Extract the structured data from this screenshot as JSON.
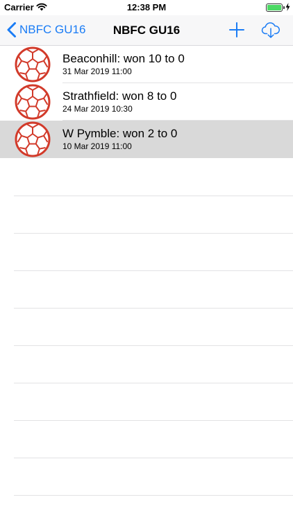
{
  "status_bar": {
    "carrier": "Carrier",
    "time": "12:38 PM",
    "battery_level": 1.0
  },
  "nav": {
    "back_label": "NBFC GU16",
    "title": "NBFC GU16",
    "add_icon": "plus-icon",
    "cloud_icon": "cloud-download-icon",
    "tint_color": "#1a7cf5"
  },
  "matches": [
    {
      "title": "Beaconhill: won 10 to 0",
      "datetime": "31 Mar 2019 11:00",
      "selected": false,
      "icon": "soccer-ball-icon"
    },
    {
      "title": "Strathfield: won 8 to 0",
      "datetime": "24 Mar 2019 10:30",
      "selected": false,
      "icon": "soccer-ball-icon"
    },
    {
      "title": "W Pymble: won 2 to 0",
      "datetime": "10 Mar 2019 11:00",
      "selected": true,
      "icon": "soccer-ball-icon"
    }
  ],
  "colors": {
    "ball": "#d23a2a",
    "selected_row": "#d9d9d9",
    "separator": "#e2e2e4"
  }
}
